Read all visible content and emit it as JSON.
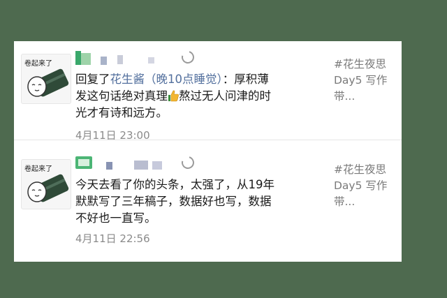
{
  "comments": [
    {
      "avatar_caption": "卷起来了",
      "reply_prefix": "回复了",
      "reply_target": "花生酱（晚10点睡觉）",
      "text_after_target": "：厚积薄发这句话绝对真理",
      "text_after_emoji": "熬过无人问津的时光才有诗和远方。",
      "emoji": "thumbs-up-icon",
      "timestamp": "4月11日 23:00",
      "tag": "#花生夜思 Day5 写作带..."
    },
    {
      "avatar_caption": "卷起来了",
      "text": "今天去看了你的头条，太强了，从19年默默写了三年稿子，数据好也写，数据不好也一直写。",
      "timestamp": "4月11日 22:56",
      "tag": "#花生夜思 Day5 写作带..."
    }
  ],
  "colors": {
    "background": "#4e6a4f",
    "link": "#526f9d",
    "timestamp": "#8a8a8a",
    "tag": "#7a7a7a"
  }
}
